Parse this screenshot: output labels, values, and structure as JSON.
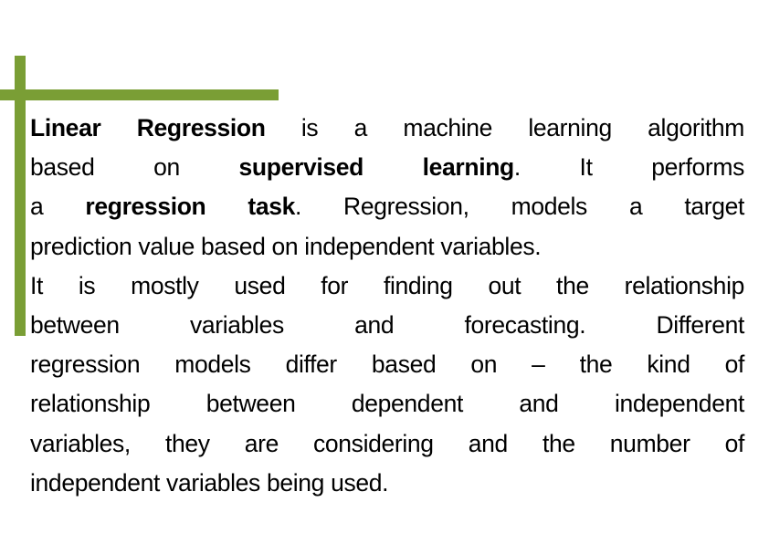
{
  "slide": {
    "accent_color": "#7a9e35",
    "paragraph": {
      "lines": [
        {
          "last": false,
          "segments": [
            {
              "text": "Linear Regression",
              "bold": true
            },
            {
              "text": " is a machine learning algorithm",
              "bold": false
            }
          ]
        },
        {
          "last": false,
          "segments": [
            {
              "text": "based on ",
              "bold": false
            },
            {
              "text": "supervised learning",
              "bold": true
            },
            {
              "text": ". It performs",
              "bold": false
            }
          ]
        },
        {
          "last": false,
          "segments": [
            {
              "text": "a ",
              "bold": false
            },
            {
              "text": "regression task",
              "bold": true
            },
            {
              "text": ". Regression, models a target",
              "bold": false
            }
          ]
        },
        {
          "last": true,
          "segments": [
            {
              "text": "prediction value based on independent variables.",
              "bold": false
            }
          ]
        },
        {
          "last": false,
          "segments": [
            {
              "text": "It is mostly used for finding out the relationship",
              "bold": false
            }
          ]
        },
        {
          "last": false,
          "segments": [
            {
              "text": "between variables and forecasting. Different",
              "bold": false
            }
          ]
        },
        {
          "last": false,
          "segments": [
            {
              "text": "regression models differ based on – the kind of",
              "bold": false
            }
          ]
        },
        {
          "last": false,
          "segments": [
            {
              "text": "relationship between dependent and independent",
              "bold": false
            }
          ]
        },
        {
          "last": false,
          "segments": [
            {
              "text": "variables, they are considering and the number of",
              "bold": false
            }
          ]
        },
        {
          "last": true,
          "segments": [
            {
              "text": "independent variables being used.",
              "bold": false
            }
          ]
        }
      ]
    }
  }
}
